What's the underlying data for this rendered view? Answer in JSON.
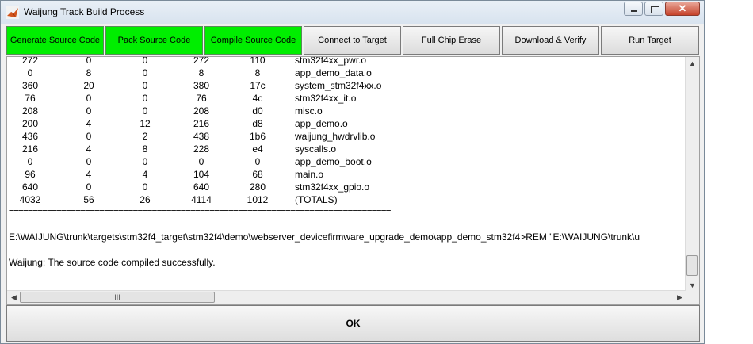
{
  "window": {
    "title": "Waijung Track Build Process",
    "buttons": {
      "minimize": "minimize",
      "maximize": "maximize",
      "close": "✕"
    }
  },
  "toolbar": {
    "generate": "Generate Source Code",
    "pack": "Pack Source Code",
    "compile": "Compile Source Code",
    "connect": "Connect to Target",
    "erase": "Full Chip Erase",
    "download": "Download & Verify",
    "run": "Run Target",
    "status_green": "#00ee00"
  },
  "output": {
    "rows": [
      [
        "272",
        "0",
        "0",
        "272",
        "110",
        "stm32f4xx_pwr.o"
      ],
      [
        "0",
        "8",
        "0",
        "8",
        "8",
        "app_demo_data.o"
      ],
      [
        "360",
        "20",
        "0",
        "380",
        "17c",
        "system_stm32f4xx.o"
      ],
      [
        "76",
        "0",
        "0",
        "76",
        "4c",
        "stm32f4xx_it.o"
      ],
      [
        "208",
        "0",
        "0",
        "208",
        "d0",
        "misc.o"
      ],
      [
        "200",
        "4",
        "12",
        "216",
        "d8",
        "app_demo.o"
      ],
      [
        "436",
        "0",
        "2",
        "438",
        "1b6",
        "waijung_hwdrvlib.o"
      ],
      [
        "216",
        "4",
        "8",
        "228",
        "e4",
        "syscalls.o"
      ],
      [
        "0",
        "0",
        "0",
        "0",
        "0",
        "app_demo_boot.o"
      ],
      [
        "96",
        "4",
        "4",
        "104",
        "68",
        "main.o"
      ],
      [
        "640",
        "0",
        "0",
        "640",
        "280",
        "stm32f4xx_gpio.o"
      ],
      [
        "4032",
        "56",
        "26",
        "4114",
        "1012",
        "(TOTALS)"
      ]
    ],
    "separator": "================================================================================",
    "command": "E:\\WAIJUNG\\trunk\\targets\\stm32f4_target\\stm32f4\\demo\\webserver_devicefirmware_upgrade_demo\\app_demo_stm32f4>REM \"E:\\WAIJUNG\\trunk\\u",
    "message": "Waijung: The source code compiled successfully.",
    "scroll_arrows": {
      "up": "▲",
      "down": "▼",
      "left": "◀",
      "right": "▶"
    },
    "hthumb_grip": "III"
  },
  "ok_label": "OK"
}
